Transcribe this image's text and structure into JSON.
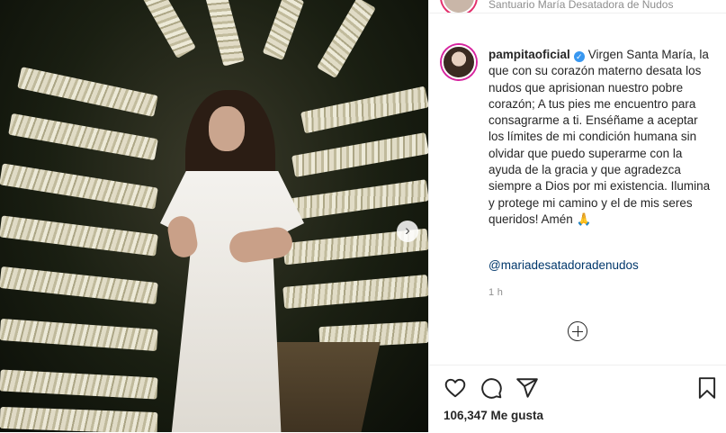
{
  "location": {
    "text": "Santuario María Desatadora de Nudos"
  },
  "post": {
    "username": "pampitaoficial",
    "caption": "Virgen Santa María, la que con su corazón materno desata los nudos que aprisionan nuestro pobre corazón; A tus pies me encuentro para consagrarme a ti. Enséñame a aceptar los límites de mi condición humana sin olvidar que puedo superarme con la ayuda de la gracia y que agradezca siempre a Dios por mi existencia. Ilumina y protege mi camino y el de mis seres queridos! Amén 🙏",
    "mention": "@mariadesatadoradenudos",
    "time": "1 h",
    "likes": "106,347 Me gusta"
  },
  "icons": {
    "verified": "verified-badge-icon",
    "next": "chevron-right-icon",
    "add_comment": "plus-circle-icon",
    "like": "heart-icon",
    "comment": "comment-bubble-icon",
    "share": "paper-plane-icon",
    "save": "bookmark-icon"
  },
  "colors": {
    "verified": "#3897f0",
    "mention": "#00376b",
    "muted": "#8e8e8e",
    "text": "#262626"
  }
}
